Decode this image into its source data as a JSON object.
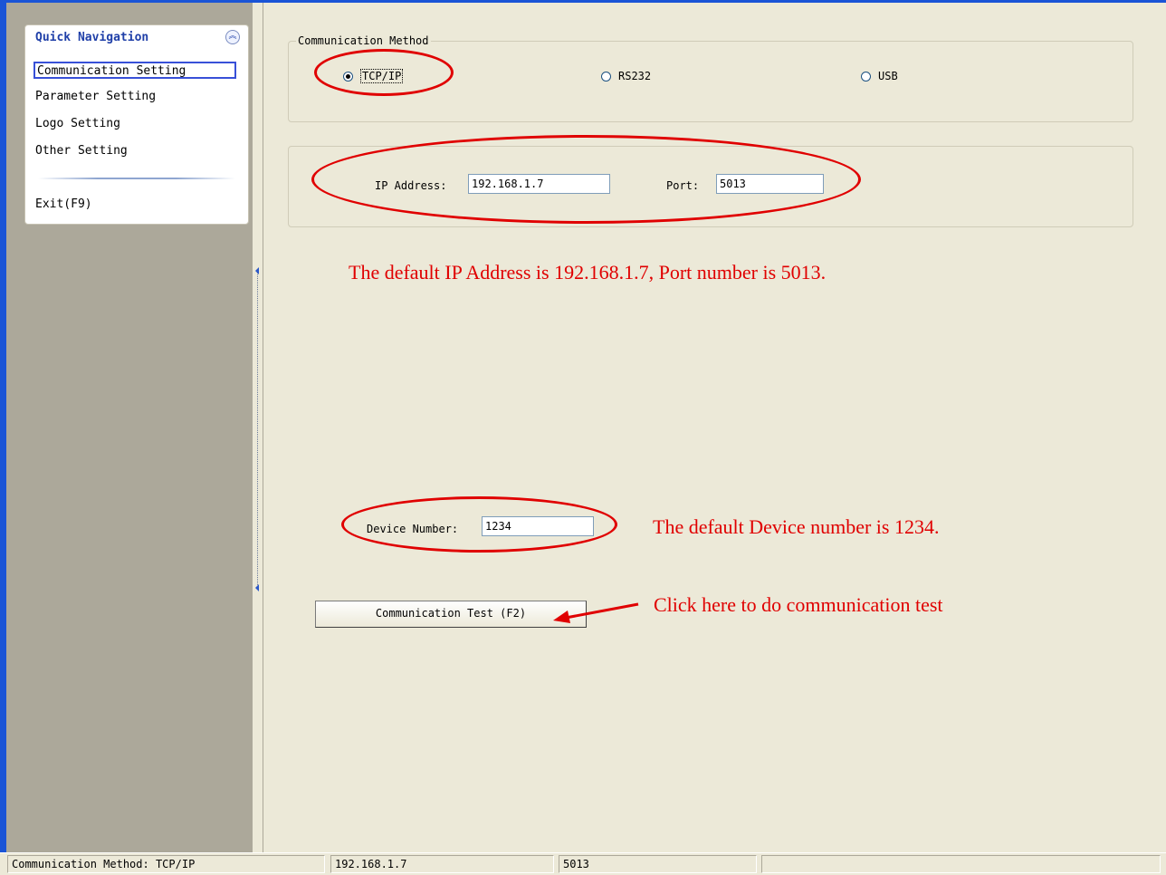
{
  "sidebar": {
    "title": "Quick Navigation",
    "collapse_icon": "chevron-double-up-icon",
    "items": [
      {
        "label": "Communication Setting",
        "active": true
      },
      {
        "label": "Parameter Setting"
      },
      {
        "label": "Logo Setting"
      },
      {
        "label": "Other Setting"
      }
    ],
    "exit_label": "Exit(F9)"
  },
  "communication": {
    "group_label": "Communication Method",
    "options": [
      "TCP/IP",
      "RS232",
      "USB"
    ],
    "selected": "TCP/IP"
  },
  "network": {
    "ip_label": "IP Address:",
    "ip_value": "192.168.1.7",
    "port_label": "Port:",
    "port_value": "5013"
  },
  "device": {
    "label": "Device Number:",
    "value": "1234"
  },
  "test_button": {
    "label": "Communication Test (F2)"
  },
  "annotations": {
    "ip_note": "The default IP Address is 192.168.1.7, Port number is 5013.",
    "device_note": "The default Device number is 1234.",
    "test_note": "Click here to do communication test",
    "color": "#e00000"
  },
  "statusbar": {
    "method": "Communication Method: TCP/IP",
    "ip": "192.168.1.7",
    "port": "5013",
    "extra": ""
  }
}
